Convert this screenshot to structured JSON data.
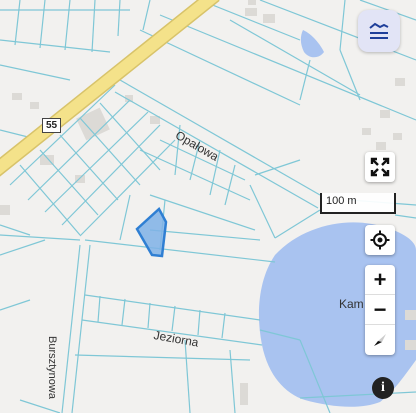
{
  "map": {
    "route_number": "55",
    "streets": {
      "opalowa": "Opałowa",
      "jeziorna": "Jeziorna",
      "vertical_street": "Bursztynowa"
    },
    "water_label": "Kam"
  },
  "scale": {
    "label": "100 m"
  },
  "controls": {
    "layers_icon": "layers-icon",
    "fullscreen_icon": "fullscreen-icon",
    "locate_icon": "locate-icon",
    "zoom_in": "+",
    "zoom_out": "−",
    "compass_icon": "compass-icon",
    "info": "i"
  },
  "colors": {
    "background": "#f2f1ef",
    "parcel_lines": "#7fc7d6",
    "road_fill": "#f4e28a",
    "water": "#a9c3f0",
    "selected_parcel": "#4b8fdc",
    "accent": "#1f3f9a"
  }
}
